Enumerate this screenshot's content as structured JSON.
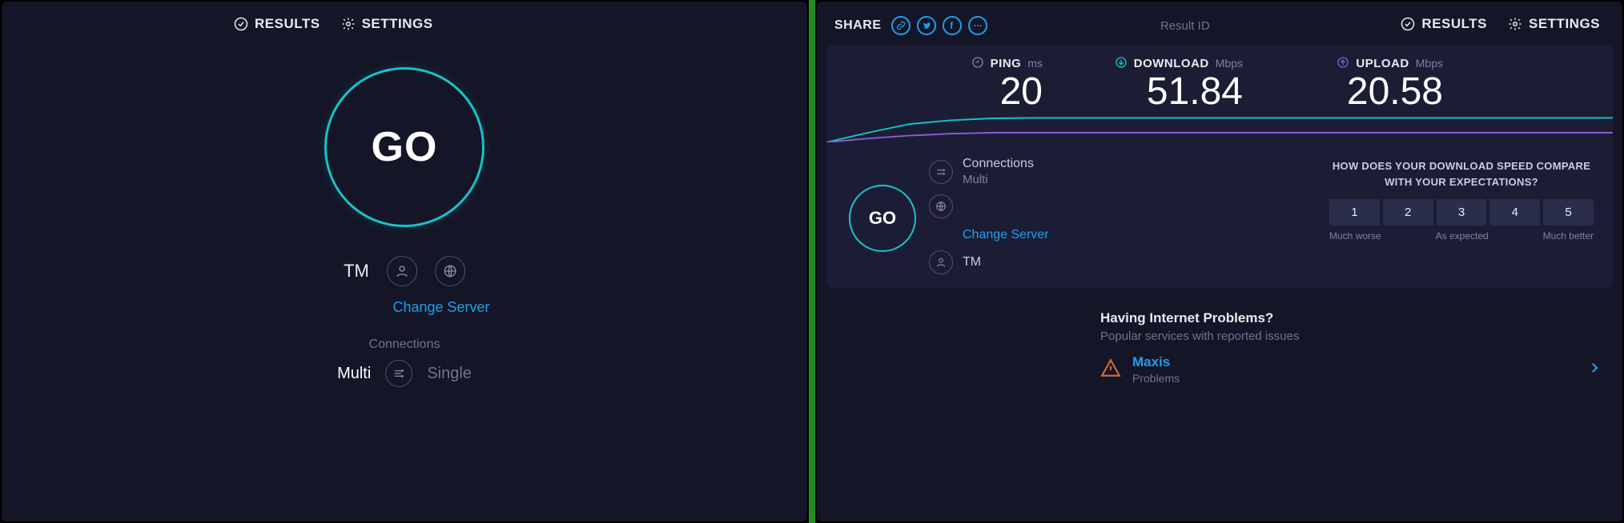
{
  "nav": {
    "results": "RESULTS",
    "settings": "SETTINGS"
  },
  "left": {
    "go": "GO",
    "isp": "TM",
    "change_server": "Change Server",
    "connections_label": "Connections",
    "conn_multi": "Multi",
    "conn_single": "Single"
  },
  "right": {
    "share_label": "SHARE",
    "result_id_label": "Result ID",
    "ping": {
      "label": "PING",
      "unit": "ms",
      "value": "20"
    },
    "download": {
      "label": "DOWNLOAD",
      "unit": "Mbps",
      "value": "51.84"
    },
    "upload": {
      "label": "UPLOAD",
      "unit": "Mbps",
      "value": "20.58"
    },
    "go_small": "GO",
    "connections": {
      "title": "Connections",
      "mode": "Multi"
    },
    "change_server": "Change Server",
    "isp": "TM",
    "survey": {
      "question_l1": "HOW DOES YOUR DOWNLOAD SPEED COMPARE",
      "question_l2": "WITH YOUR EXPECTATIONS?",
      "options": [
        "1",
        "2",
        "3",
        "4",
        "5"
      ],
      "label_low": "Much worse",
      "label_mid": "As expected",
      "label_high": "Much better"
    },
    "problems": {
      "title": "Having Internet Problems?",
      "sub": "Popular services with reported issues",
      "service": "Maxis",
      "status": "Problems"
    }
  },
  "chart_data": {
    "type": "line",
    "title": "Speed over time",
    "xlabel": "",
    "ylabel": "",
    "series": [
      {
        "name": "download",
        "color": "#18c3c8",
        "values": [
          0,
          20,
          38,
          46,
          50,
          51,
          51,
          51,
          51,
          51,
          51,
          51,
          51,
          51,
          51,
          51,
          51,
          51,
          51,
          51
        ]
      },
      {
        "name": "upload",
        "color": "#8a5bd6",
        "values": [
          0,
          8,
          14,
          18,
          20,
          20,
          20,
          20,
          20,
          20,
          20,
          20,
          20,
          20,
          20,
          20,
          20,
          20,
          20,
          20
        ]
      }
    ],
    "ylim": [
      0,
      60
    ]
  }
}
